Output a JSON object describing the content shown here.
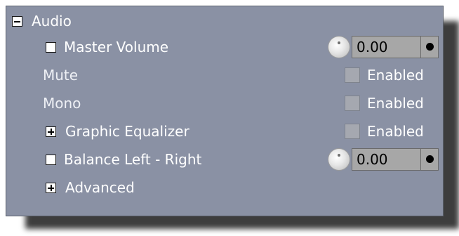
{
  "audio": {
    "title": "Audio",
    "expanded": true,
    "rows": [
      {
        "id": "master_volume",
        "label": "Master Volume",
        "control": "knob",
        "value": "0.00"
      },
      {
        "id": "mute",
        "label": "Mute",
        "control": "checkbox",
        "checkbox_label": "Enabled",
        "checked": false
      },
      {
        "id": "mono",
        "label": "Mono",
        "control": "checkbox",
        "checkbox_label": "Enabled",
        "checked": false
      },
      {
        "id": "graphic_equalizer",
        "label": "Graphic Equalizer",
        "control": "checkbox",
        "checkbox_label": "Enabled",
        "checked": false,
        "expandable": true
      },
      {
        "id": "balance",
        "label": "Balance Left - Right",
        "control": "knob",
        "value": "0.00"
      },
      {
        "id": "advanced",
        "label": "Advanced",
        "expandable": true
      }
    ]
  },
  "icons": {
    "collapse": "minus-box-icon",
    "expand": "plus-box-icon",
    "row_box": "square-box-icon",
    "knob": "knob-icon",
    "spin": "dot-button-icon"
  },
  "colors": {
    "panel_bg": "#8a91a4",
    "text": "#ffffff",
    "field_bg": "#a7a7a7"
  }
}
